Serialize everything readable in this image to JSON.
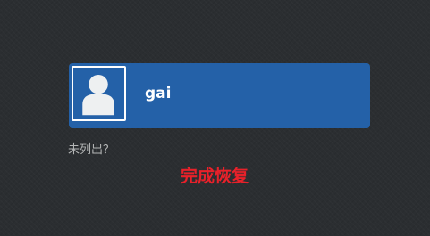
{
  "user": {
    "name": "gai",
    "avatar_icon": "user-silhouette-icon"
  },
  "login": {
    "not_listed_label": "未列出？"
  },
  "overlay": {
    "status_text": "完成恢复",
    "status_color": "#e8212a"
  },
  "colors": {
    "background": "#2b2e31",
    "selection": "#2461a8"
  }
}
